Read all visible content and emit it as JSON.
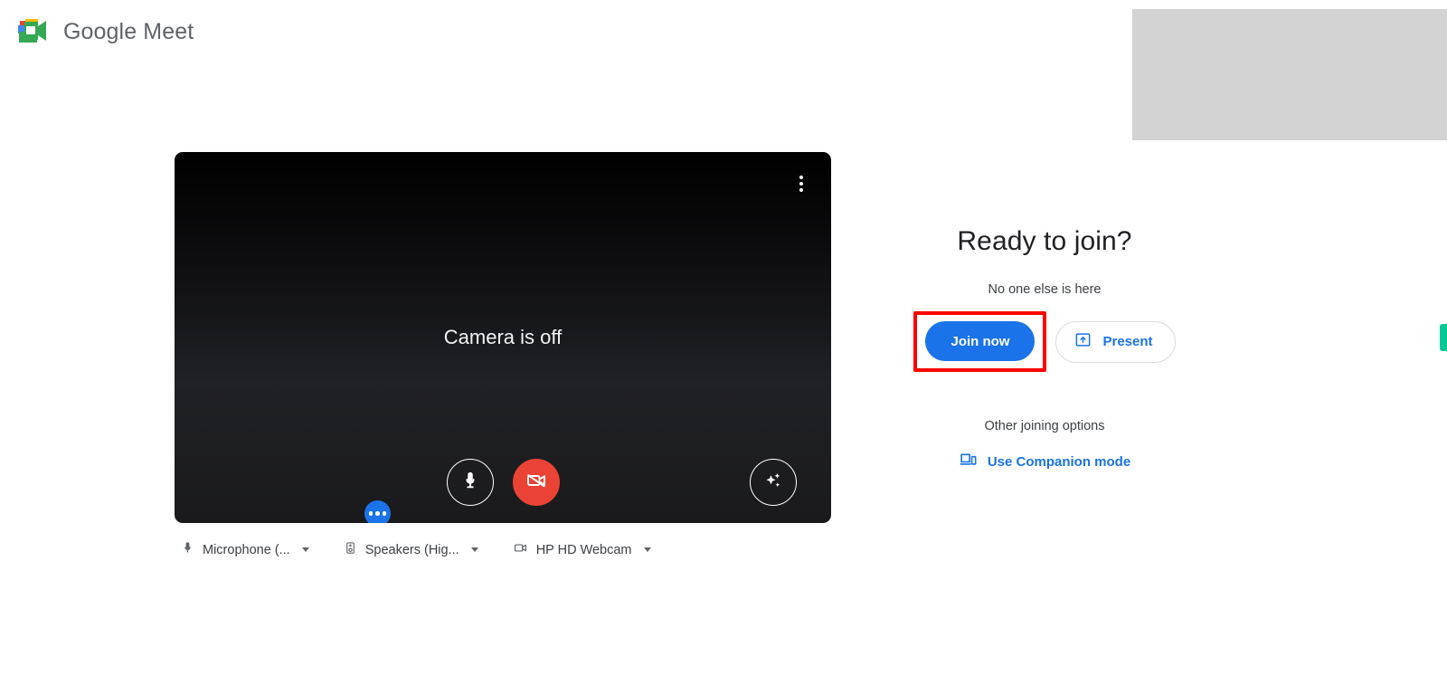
{
  "brand": {
    "logo_icon": "google-meet-logo-icon",
    "name_part1": "Google",
    "name_part2": "Meet"
  },
  "preview": {
    "status_label": "Camera is off",
    "more_options_icon": "more-vertical-icon",
    "mic_icon": "microphone-icon",
    "camera_off_icon": "camera-off-icon",
    "effects_icon": "sparkle-effects-icon",
    "dots_icon": "more-horizontal-icon"
  },
  "devices": [
    {
      "icon": "microphone-icon",
      "label": "Microphone (...",
      "caret": "chevron-down-icon"
    },
    {
      "icon": "speaker-icon",
      "label": "Speakers (Hig...",
      "caret": "chevron-down-icon"
    },
    {
      "icon": "video-camera-icon",
      "label": "HP HD Webcam",
      "caret": "chevron-down-icon"
    }
  ],
  "join": {
    "title": "Ready to join?",
    "subtitle": "No one else is here",
    "join_button_label": "Join now",
    "present_button_label": "Present",
    "present_icon": "present-screen-icon",
    "other_options_label": "Other joining options",
    "companion_label": "Use Companion mode",
    "companion_icon": "companion-devices-icon"
  },
  "colors": {
    "accent_blue": "#1a73e8",
    "danger_red": "#ea4335",
    "highlight_red": "#ff0000",
    "edge_green": "#05c995",
    "panel_gray": "#d3d3d3"
  }
}
